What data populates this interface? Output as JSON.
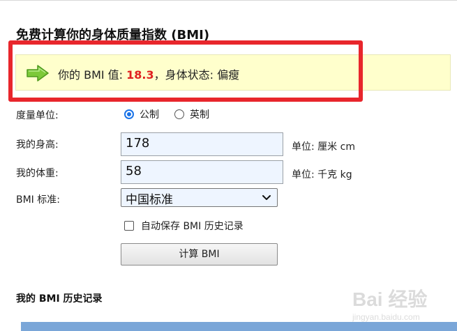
{
  "page": {
    "title": "免费计算你的身体质量指数 (BMI)"
  },
  "result": {
    "prefix": "你的 BMI 值: ",
    "bmi_value": "18.3",
    "separator": "，",
    "status_label": "身体状态:",
    "status_value": "偏瘦"
  },
  "form": {
    "unit_label": "度量单位:",
    "unit_options": [
      {
        "label": "公制",
        "checked": true
      },
      {
        "label": "英制",
        "checked": false
      }
    ],
    "height_label": "我的身高:",
    "height_value": "178",
    "height_unit": "单位: 厘米 cm",
    "weight_label": "我的体重:",
    "weight_value": "58",
    "weight_unit": "单位: 千克 kg",
    "standard_label": "BMI 标准:",
    "standard_selected": "中国标准",
    "autosave_label": "自动保存 BMI 历史记录",
    "autosave_checked": false,
    "calculate_button": "计算 BMI"
  },
  "history": {
    "title": "我的 BMI 历史记录"
  },
  "colors": {
    "result_bg": "#ffffcc",
    "bmi_value": "#e02020",
    "highlight_box": "#e8262c",
    "input_bg": "#eef5ff",
    "arrow_green": "#7dc93a",
    "table_header": "#7aa6d8"
  },
  "watermark": {
    "text": "Bai 经验",
    "sub": "jingyan.baidu.com"
  }
}
